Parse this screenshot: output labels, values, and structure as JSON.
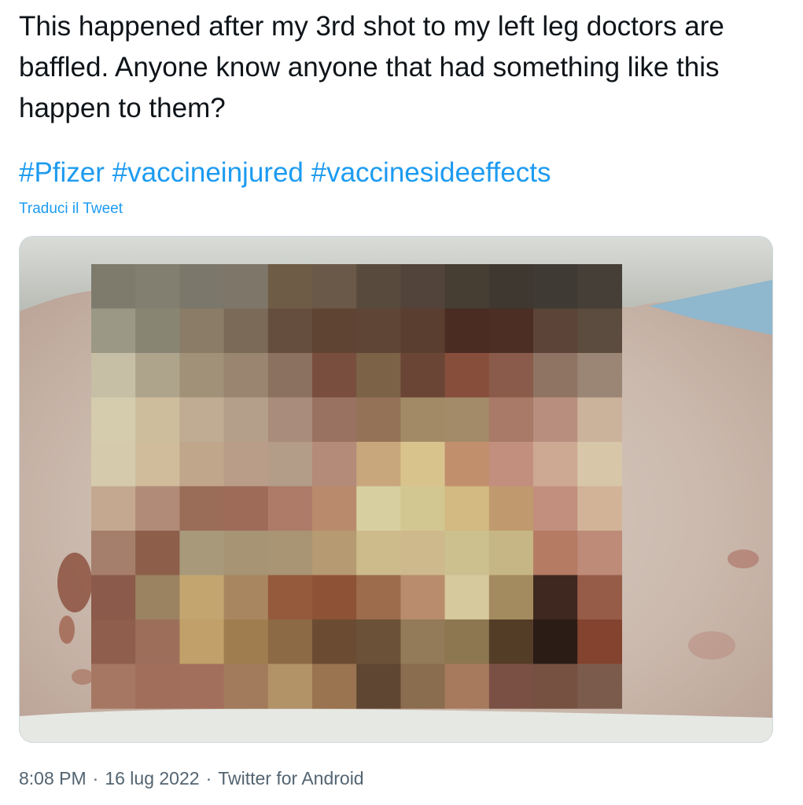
{
  "tweet": {
    "text": "This happened after my 3rd shot to my left leg doctors are baffled. Anyone know anyone that had something like this happen to them?",
    "hashtags": [
      "#Pfizer",
      "#vaccineinjured",
      "#vaccinesideeffects"
    ],
    "translate_label": "Traduci il Tweet",
    "time": "8:08 PM",
    "separator": "·",
    "date": "16 lug 2022",
    "source": "Twitter for Android"
  },
  "media": {
    "description_icon": "pixelated-photo",
    "mosaic_colors": [
      [
        "#7e7b6d",
        "#827e70",
        "#7b776a",
        "#7e7668",
        "#6e5c47",
        "#6a5848",
        "#584a3d",
        "#52443a",
        "#463d33",
        "#3e3831",
        "#403a34",
        "#453f38"
      ],
      [
        "#9b9886",
        "#898573",
        "#8b7c68",
        "#7b6a58",
        "#654e3e",
        "#5f4333",
        "#5e4535",
        "#5a3f31",
        "#4b2c23",
        "#4c2e25",
        "#5c4538",
        "#5c4c3f"
      ],
      [
        "#c6bea5",
        "#aea48c",
        "#a29179",
        "#9a8670",
        "#8b715f",
        "#794e3f",
        "#7c6247",
        "#6a4536",
        "#874f3b",
        "#8a5b4a",
        "#8f7464",
        "#9b8574"
      ],
      [
        "#d5cbad",
        "#cdbd9d",
        "#bfac92",
        "#b4a08a",
        "#a98c7b",
        "#9a7262",
        "#937257",
        "#a38a67",
        "#a38a69",
        "#a97a68",
        "#b88f7e",
        "#cbb29a"
      ],
      [
        "#d5cbac",
        "#d0bb9a",
        "#c0a68a",
        "#b99d88",
        "#b39c88",
        "#b48a79",
        "#c8a77d",
        "#d8c38d",
        "#c28f6d",
        "#c28f7e",
        "#cda893",
        "#d7c6a8"
      ],
      [
        "#c4a890",
        "#b18b78",
        "#9a6d58",
        "#9e6b59",
        "#ae7b69",
        "#b98b6c",
        "#d7cf9f",
        "#d2c790",
        "#d3b982",
        "#c09a6e",
        "#c28f7e",
        "#d2b397"
      ],
      [
        "#a57f6c",
        "#8d5f4a",
        "#a8997a",
        "#a69474",
        "#a99474",
        "#b69a72",
        "#cdbb8b",
        "#ceb98c",
        "#cbc08e",
        "#c7b685",
        "#b57c63",
        "#bd8b78"
      ],
      [
        "#8b5a4a",
        "#9b8361",
        "#c2a56f",
        "#a88660",
        "#955a3c",
        "#8e5336",
        "#9c6c4c",
        "#b88c6c",
        "#d6c99d",
        "#a48b5f",
        "#3f2820",
        "#975c48"
      ],
      [
        "#8f5e4c",
        "#9d6f5b",
        "#c1a069",
        "#a07d4f",
        "#8c6a45",
        "#6b4c32",
        "#6b5138",
        "#937a58",
        "#8d7750",
        "#543d27",
        "#2b1c16",
        "#84432f"
      ],
      [
        "#a67863",
        "#a06e5b",
        "#a36f5d",
        "#a27b5c",
        "#b29267",
        "#9a7350",
        "#5f4632",
        "#8a6c4e",
        "#a87a5d",
        "#7a5045",
        "#765040",
        "#7b5c4c"
      ]
    ]
  }
}
